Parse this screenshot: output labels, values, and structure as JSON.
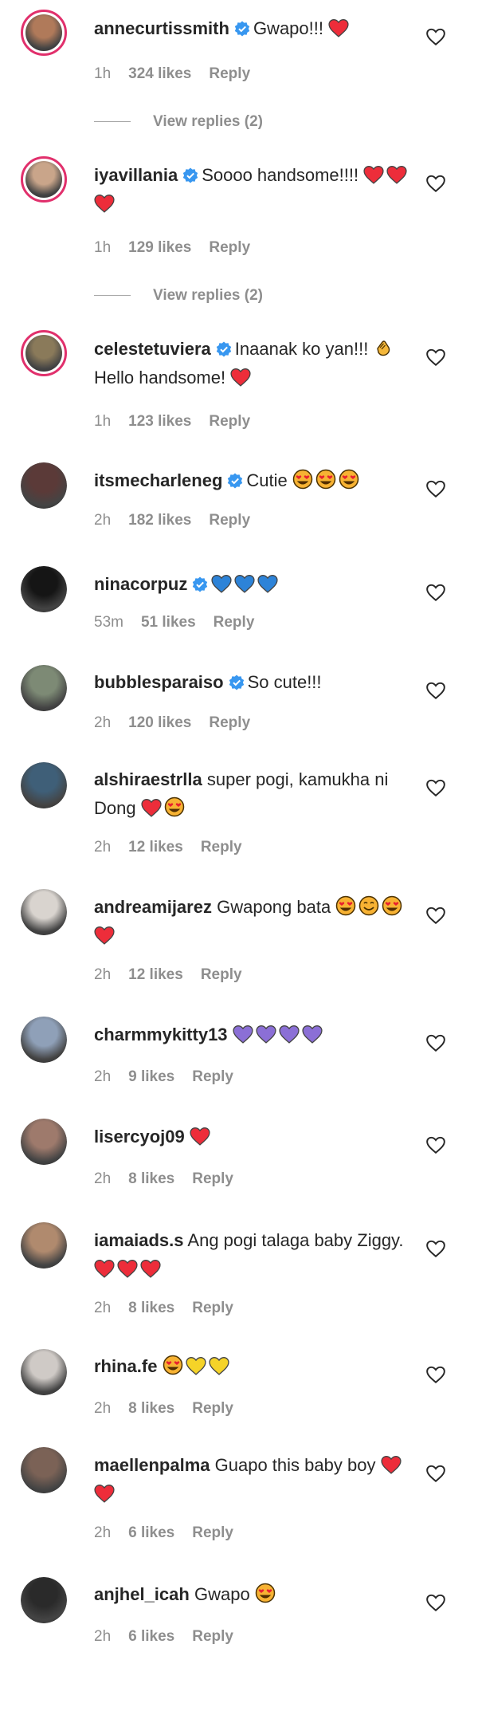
{
  "comments": [
    {
      "user": "annecurtissmith",
      "verified": true,
      "text": "Gwapo!!!",
      "emoji": [
        "red-heart"
      ],
      "time": "1h",
      "likes": "324 likes",
      "reply": "Reply",
      "view_replies": "View replies (2)",
      "avatar_color": "#b07a5a",
      "ring": true
    },
    {
      "user": "iyavillania",
      "verified": true,
      "text": "Soooo handsome!!!!",
      "emoji": [
        "red-heart",
        "red-heart",
        "red-heart"
      ],
      "time": "1h",
      "likes": "129 likes",
      "reply": "Reply",
      "view_replies": "View replies (2)",
      "avatar_color": "#c9a58a",
      "ring": true
    },
    {
      "user": "celestetuviera",
      "verified": true,
      "text": "Inaanak ko yan!!!",
      "emoji_mid": [
        "clap"
      ],
      "text2": "Hello handsome!",
      "emoji": [
        "red-heart"
      ],
      "time": "1h",
      "likes": "123 likes",
      "reply": "Reply",
      "avatar_color": "#8a7a5a",
      "ring": true
    },
    {
      "user": "itsmecharleneg",
      "verified": true,
      "text": "Cutie",
      "emoji": [
        "heart-eyes",
        "heart-eyes",
        "heart-eyes"
      ],
      "time": "2h",
      "likes": "182 likes",
      "reply": "Reply",
      "avatar_color": "#5b3a38",
      "ring": false
    },
    {
      "user": "ninacorpuz",
      "verified": true,
      "text": "",
      "emoji": [
        "blue-heart",
        "blue-heart",
        "blue-heart"
      ],
      "time": "53m",
      "likes": "51 likes",
      "reply": "Reply",
      "avatar_color": "#151515",
      "ring": false
    },
    {
      "user": "bubblesparaiso",
      "verified": true,
      "text": "So cute!!!",
      "emoji": [],
      "time": "2h",
      "likes": "120 likes",
      "reply": "Reply",
      "avatar_color": "#7d8a75",
      "ring": false
    },
    {
      "user": "alshiraestrlla",
      "verified": false,
      "text": "super pogi, kamukha ni Dong",
      "emoji": [
        "red-heart",
        "heart-eyes"
      ],
      "time": "2h",
      "likes": "12 likes",
      "reply": "Reply",
      "avatar_color": "#3f5f78",
      "ring": false
    },
    {
      "user": "andreamijarez",
      "verified": false,
      "text": "Gwapong bata",
      "emoji": [
        "heart-eyes",
        "smile",
        "heart-eyes",
        "red-heart"
      ],
      "time": "2h",
      "likes": "12 likes",
      "reply": "Reply",
      "avatar_color": "#d9d4cf",
      "ring": false
    },
    {
      "user": "charmmykitty13",
      "verified": false,
      "text": "",
      "emoji": [
        "purple-heart",
        "purple-heart",
        "purple-heart",
        "purple-heart"
      ],
      "time": "2h",
      "likes": "9 likes",
      "reply": "Reply",
      "avatar_color": "#8fa0b8",
      "ring": false
    },
    {
      "user": "lisercyoj09",
      "verified": false,
      "text": "",
      "emoji": [
        "red-heart"
      ],
      "time": "2h",
      "likes": "8 likes",
      "reply": "Reply",
      "avatar_color": "#9e7a6c",
      "ring": false
    },
    {
      "user": "iamaiads.s",
      "verified": false,
      "text": "Ang pogi talaga baby Ziggy.",
      "emoji": [
        "red-heart",
        "red-heart",
        "red-heart"
      ],
      "time": "2h",
      "likes": "8 likes",
      "reply": "Reply",
      "avatar_color": "#b08a6e",
      "ring": false
    },
    {
      "user": "rhina.fe",
      "verified": false,
      "text": "",
      "emoji": [
        "heart-eyes",
        "yellow-heart",
        "yellow-heart"
      ],
      "time": "2h",
      "likes": "8 likes",
      "reply": "Reply",
      "avatar_color": "#cfcac6",
      "ring": false
    },
    {
      "user": "maellenpalma",
      "verified": false,
      "text": "Guapo this baby boy",
      "emoji": [
        "red-heart",
        "red-heart"
      ],
      "time": "2h",
      "likes": "6 likes",
      "reply": "Reply",
      "avatar_color": "#7b6256",
      "ring": false
    },
    {
      "user": "anjhel_icah",
      "verified": false,
      "text": "Gwapo",
      "emoji": [
        "heart-eyes"
      ],
      "time": "2h",
      "likes": "6 likes",
      "reply": "Reply",
      "avatar_color": "#2a2a2a",
      "ring": false
    }
  ],
  "colors": {
    "heart": "#ed2d3a",
    "blue": "#2d83d8",
    "purple": "#8b6fd6",
    "yellow": "#f5d328",
    "verified": "#3897f0",
    "muted": "#8e8e8e"
  }
}
